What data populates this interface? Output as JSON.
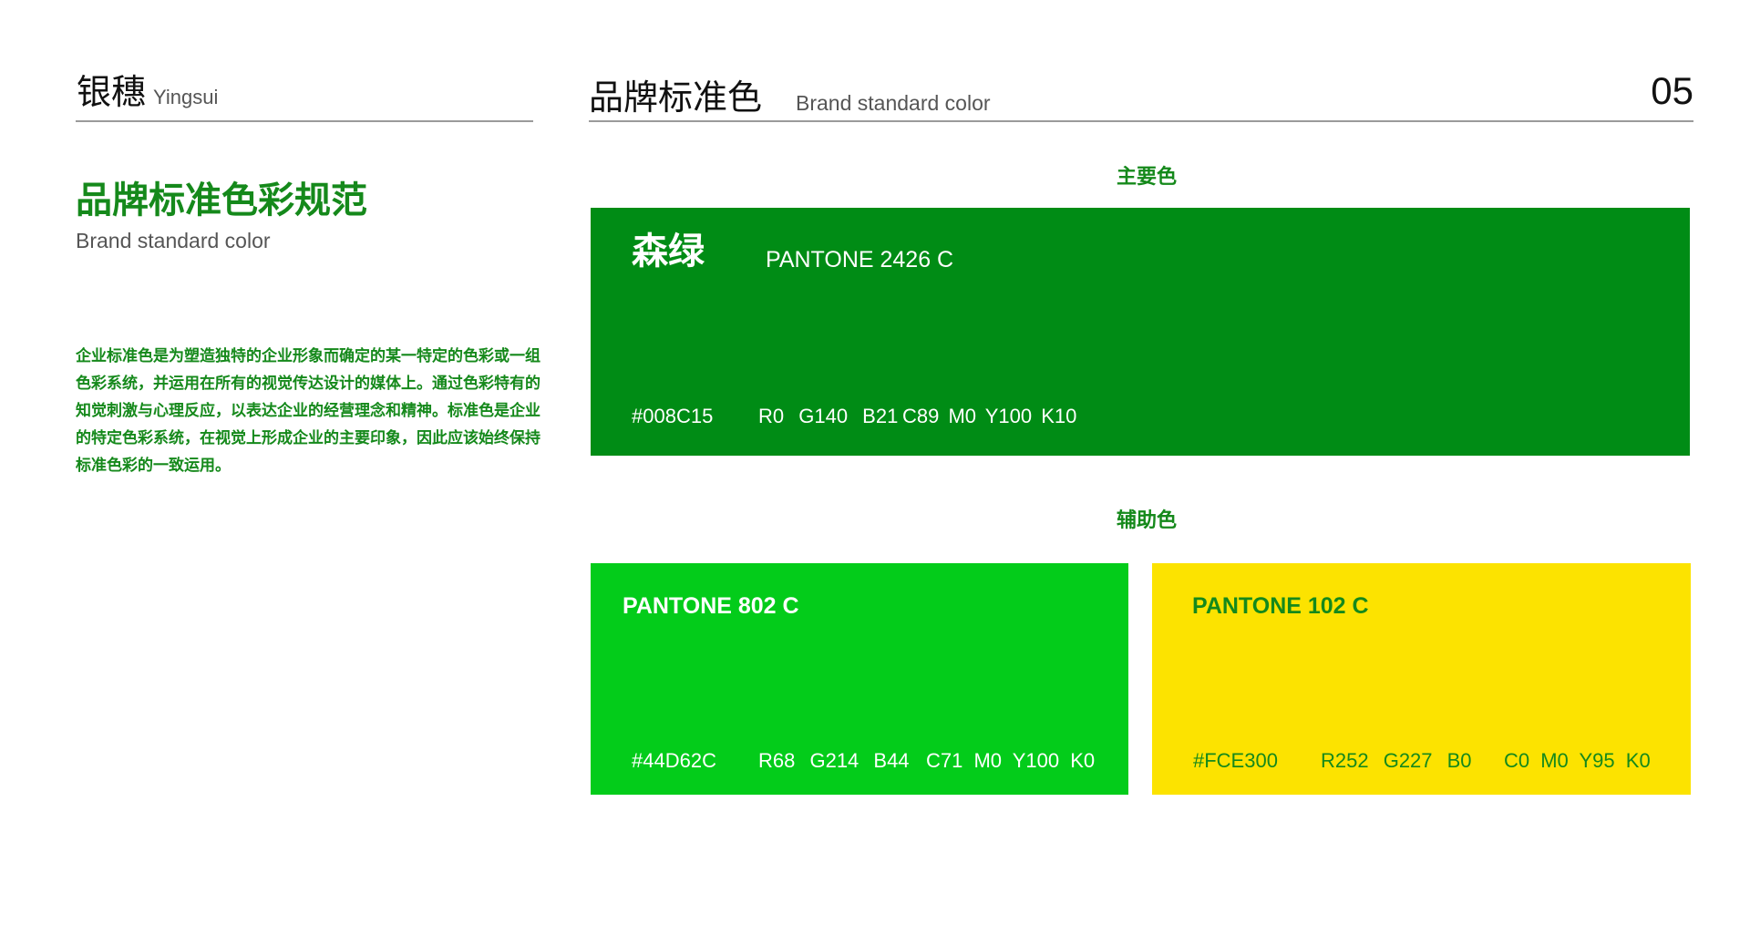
{
  "header": {
    "brand_cn": "银穗",
    "brand_en": "Yingsui",
    "section_cn": "品牌标准色",
    "section_en": "Brand standard color",
    "page_number": "05"
  },
  "left": {
    "title_cn": "品牌标准色彩规范",
    "title_en": "Brand standard color",
    "description": "企业标准色是为塑造独特的企业形象而确定的某一特定的色彩或一组色彩系统，并运用在所有的视觉传达设计的媒体上。通过色彩特有的知觉刺激与心理反应，以表达企业的经营理念和精神。标准色是企业的特定色彩系统，在视觉上形成企业的主要印象，因此应该始终保持标准色彩的一致运用。"
  },
  "labels": {
    "primary": "主要色",
    "secondary": "辅助色"
  },
  "colors": {
    "primary": {
      "name": "森绿",
      "pantone": "PANTONE 2426 C",
      "hex": "#008C15",
      "rgb": "R0  G140  B21",
      "cmyk": "C89  M0 Y100  K10",
      "fill": "#008c15",
      "text_color": "#ffffff"
    },
    "secondary": [
      {
        "pantone": "PANTONE 802 C",
        "hex": "#44D62C",
        "rgb": "R68  G214  B44",
        "cmyk": "C71  M0  Y100  K0",
        "fill": "#03cc1a",
        "text_color": "#ffffff"
      },
      {
        "pantone": "PANTONE 102 C",
        "hex": "#FCE300",
        "rgb": "R252  G227  B0",
        "cmyk": "C0  M0 Y95  K0",
        "fill": "#fce300",
        "text_color": "#15891b"
      }
    ]
  }
}
